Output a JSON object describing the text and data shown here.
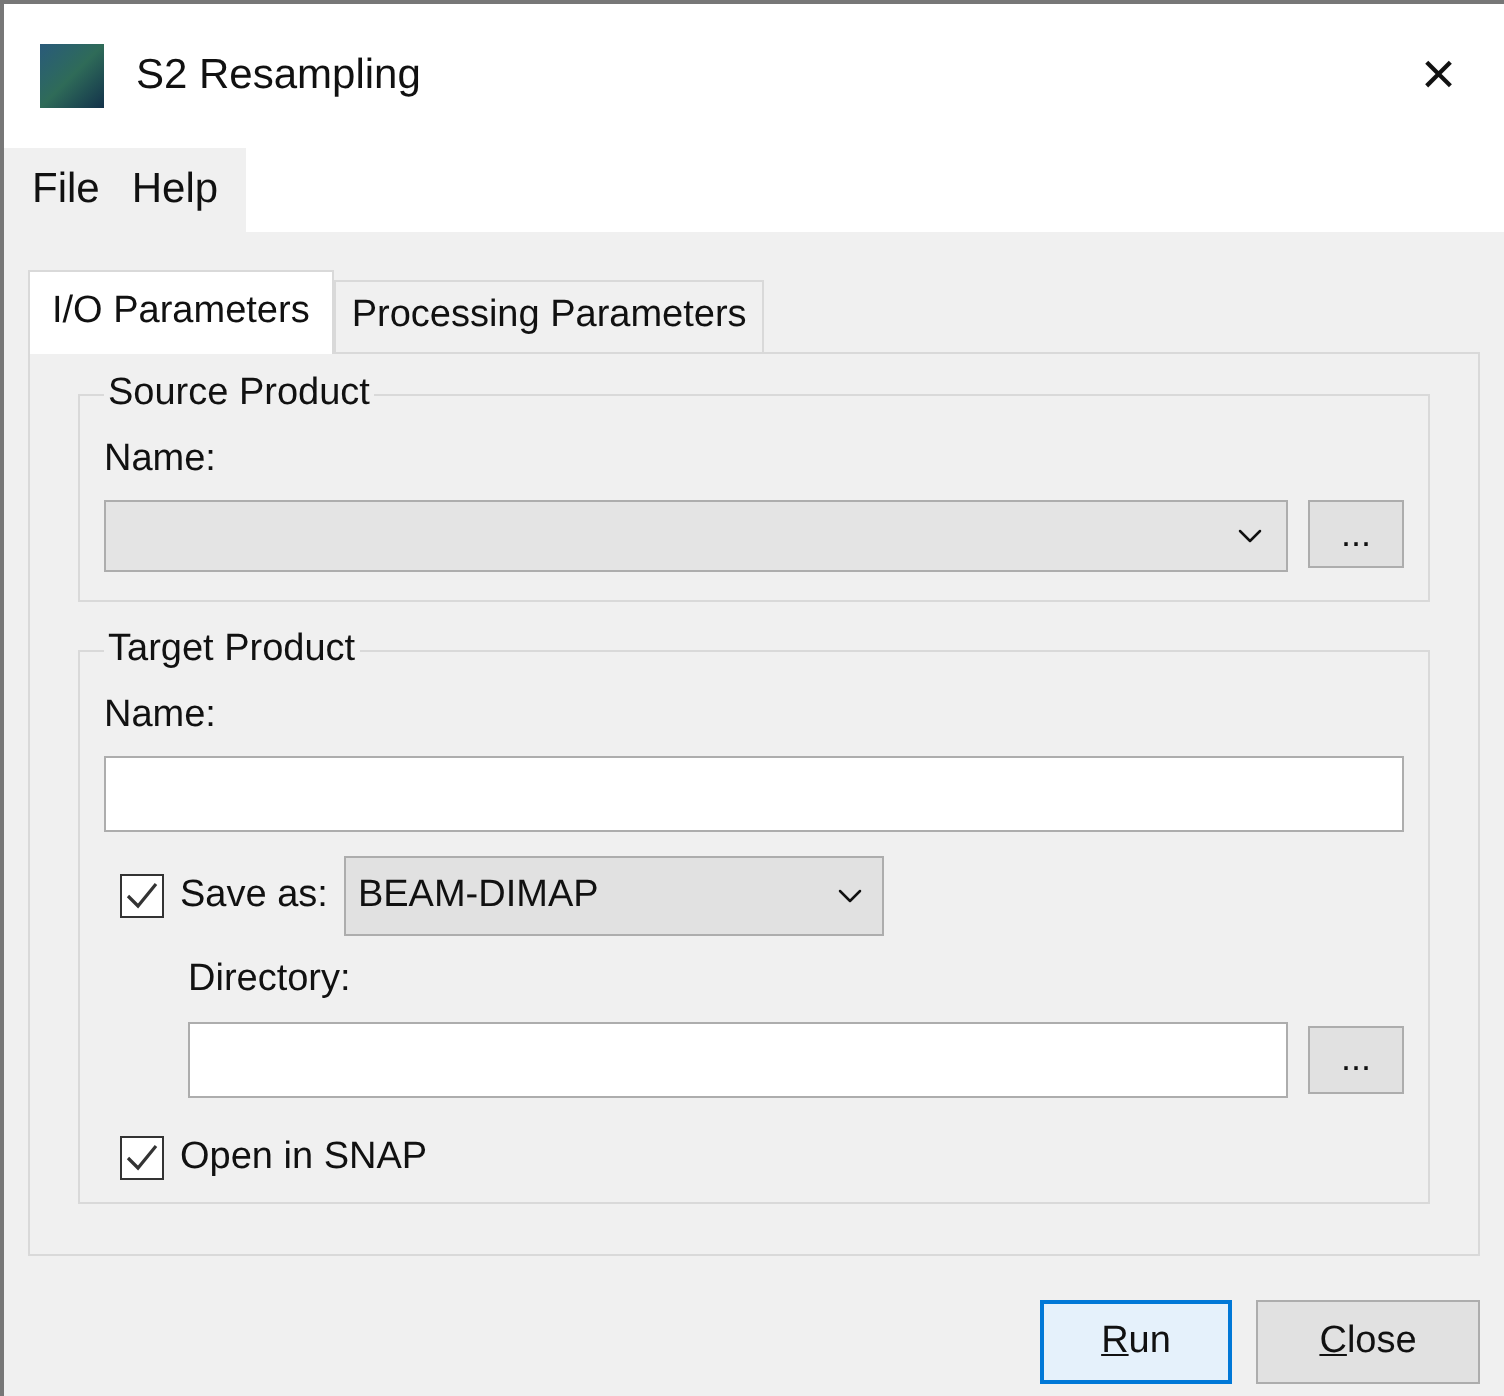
{
  "window": {
    "title": "S2 Resampling",
    "close": "×"
  },
  "menu": [
    {
      "label": "File"
    },
    {
      "label": "Help"
    }
  ],
  "tabs": [
    {
      "label": "I/O Parameters",
      "selected": true
    },
    {
      "label": "Processing Parameters",
      "selected": false
    }
  ],
  "source_product": {
    "title": "Source Product",
    "name_label": "Name:",
    "browse": "..."
  },
  "target_product": {
    "title": "Target Product",
    "name_label": "Name:",
    "save_as": {
      "label": "Save as:",
      "checked": true,
      "format": "BEAM-DIMAP"
    },
    "directory_label": "Directory:",
    "browse": "...",
    "open_in_snap": {
      "label": "Open in SNAP",
      "checked": true
    }
  },
  "buttons": [
    {
      "mnemonic": "R",
      "rest": "un",
      "default": true
    },
    {
      "mnemonic": "C",
      "rest": "lose",
      "default": false
    }
  ]
}
